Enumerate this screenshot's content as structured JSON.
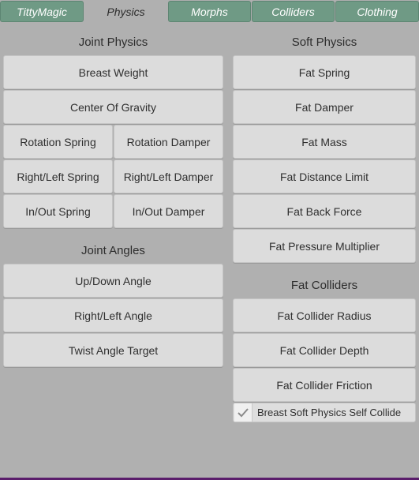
{
  "tabs": [
    {
      "label": "TittyMagic",
      "active": false
    },
    {
      "label": "Physics",
      "active": true
    },
    {
      "label": "Morphs",
      "active": false
    },
    {
      "label": "Colliders",
      "active": false
    },
    {
      "label": "Clothing",
      "active": false
    }
  ],
  "joint_physics": {
    "heading": "Joint Physics",
    "breast_weight": "Breast Weight",
    "center_of_gravity": "Center Of Gravity",
    "rotation_spring": "Rotation Spring",
    "rotation_damper": "Rotation Damper",
    "right_left_spring": "Right/Left Spring",
    "right_left_damper": "Right/Left Damper",
    "in_out_spring": "In/Out Spring",
    "in_out_damper": "In/Out Damper"
  },
  "joint_angles": {
    "heading": "Joint Angles",
    "up_down_angle": "Up/Down Angle",
    "right_left_angle": "Right/Left Angle",
    "twist_angle_target": "Twist Angle Target"
  },
  "soft_physics": {
    "heading": "Soft Physics",
    "fat_spring": "Fat Spring",
    "fat_damper": "Fat Damper",
    "fat_mass": "Fat Mass",
    "fat_distance_limit": "Fat Distance Limit",
    "fat_back_force": "Fat Back Force",
    "fat_pressure_multiplier": "Fat Pressure Multiplier"
  },
  "fat_colliders": {
    "heading": "Fat Colliders",
    "fat_collider_radius": "Fat Collider Radius",
    "fat_collider_depth": "Fat Collider Depth",
    "fat_collider_friction": "Fat Collider Friction"
  },
  "self_collide": {
    "label": "Breast Soft Physics Self Collide",
    "checked": true
  },
  "colors": {
    "background": "#b0b0b0",
    "tab_inactive": "#6f9a85",
    "button": "#dcdcdc",
    "accent_bar": "#5a1d6b"
  }
}
